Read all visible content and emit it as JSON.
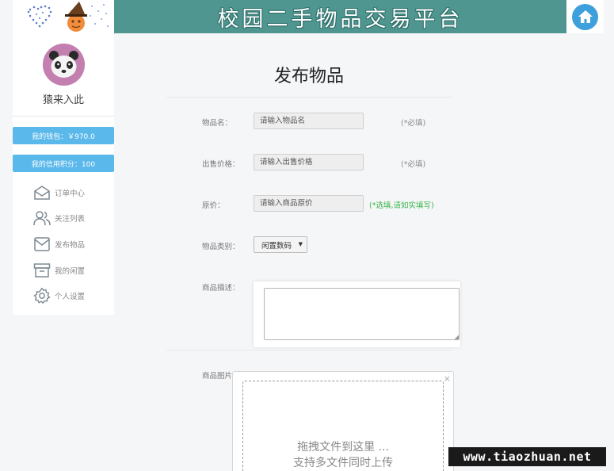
{
  "header": {
    "title": "校园二手物品交易平台",
    "home_icon": "home-icon",
    "colors": {
      "banner": "#4f9590",
      "home_button": "#3da0dc"
    }
  },
  "sidebar": {
    "username": "猿来入此",
    "wallet": "我的钱包：￥970.0",
    "credit": "我的信用积分：100",
    "pill_color": "#5ab8ea",
    "menu": [
      {
        "label": "订单中心",
        "icon": "envelope-icon"
      },
      {
        "label": "关注列表",
        "icon": "users-icon"
      },
      {
        "label": "发布物品",
        "icon": "mail-icon"
      },
      {
        "label": "我的闲置",
        "icon": "archive-icon"
      },
      {
        "label": "个人设置",
        "icon": "gear-icon"
      }
    ]
  },
  "form": {
    "title": "发布物品",
    "name_label": "物品名：",
    "name_placeholder": "请输入物品名",
    "name_hint": "(*必填)",
    "price_label": "出售价格：",
    "price_placeholder": "请输入出售价格",
    "price_hint": "(*必填)",
    "original_label": "原价：",
    "original_placeholder": "请输入商品原价",
    "original_hint": "(*选填,请如实填写)",
    "category_label": "物品类别：",
    "category_value": "闲置数码",
    "description_label": "商品描述：",
    "image_label": "商品图片：",
    "upload_line1": "拖拽文件到这里 ...",
    "upload_line2": "支持多文件同时上传",
    "upload_close": "×",
    "hint_green": "#3bb54a"
  },
  "watermark": "www.tiaozhuan.net"
}
